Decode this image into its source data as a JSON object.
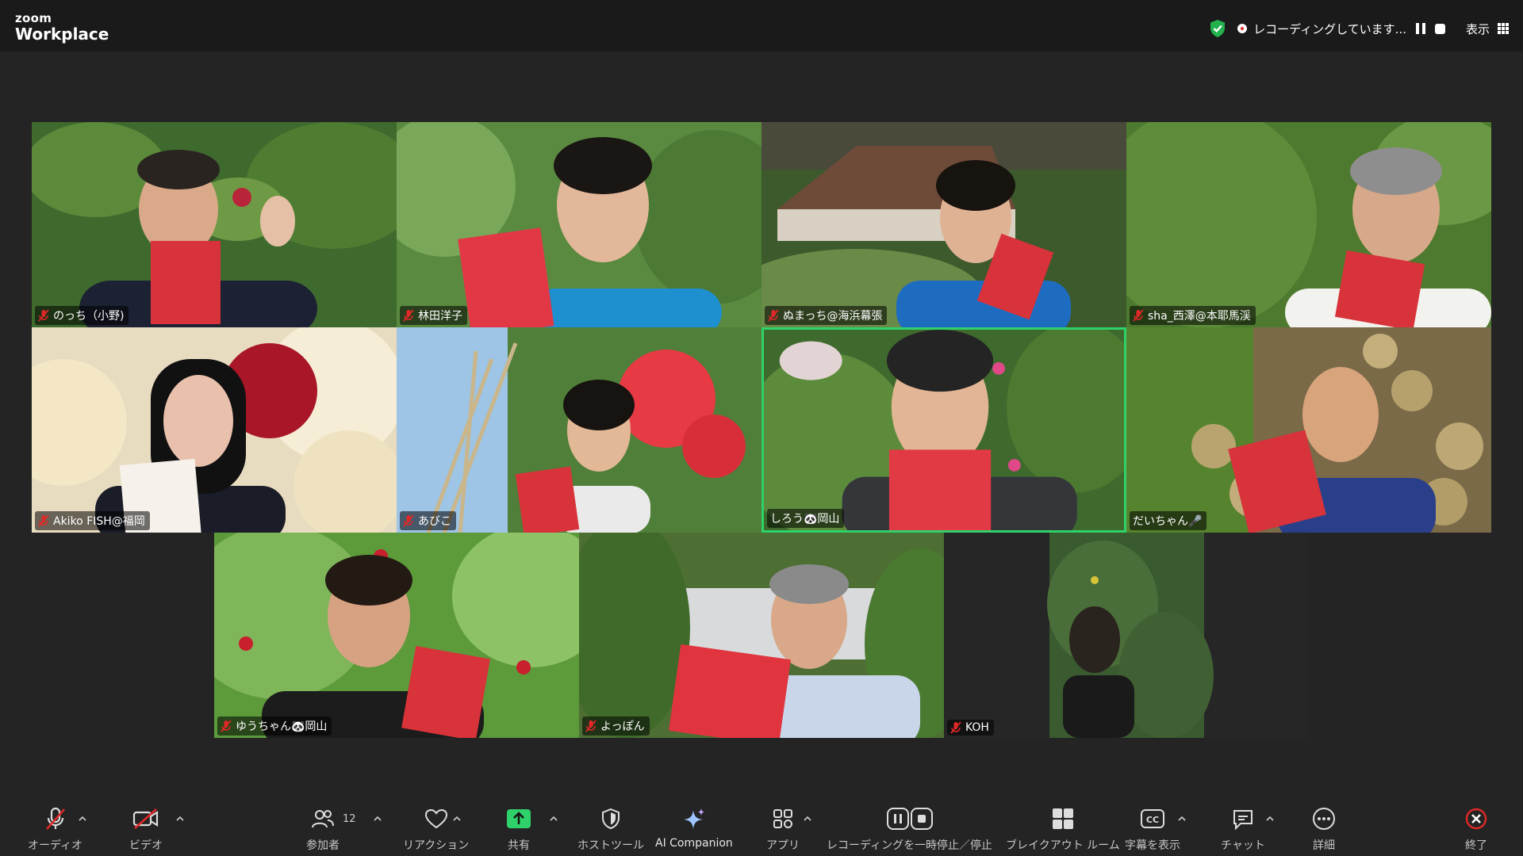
{
  "app": {
    "logo_small": "zoom",
    "logo_big": "Workplace"
  },
  "topbar": {
    "recording_status": "レコーディングしています...",
    "view_label": "表示"
  },
  "participants": [
    {
      "name": "のっち（小野)",
      "muted": true
    },
    {
      "name": "林田洋子",
      "muted": true
    },
    {
      "name": "ぬまっち@海浜幕張",
      "muted": true
    },
    {
      "name": "sha_西澤@本耶馬渓",
      "muted": true
    },
    {
      "name": "Akiko FISH@福岡",
      "muted": true
    },
    {
      "name": "あびこ",
      "muted": true
    },
    {
      "name": "しろう🐼岡山",
      "muted": false,
      "active_speaker": true
    },
    {
      "name": "だいちゃん🎤",
      "muted": false
    },
    {
      "name": "ゆうちゃん🐼岡山",
      "muted": true
    },
    {
      "name": "よっぽん",
      "muted": true
    },
    {
      "name": "KOH",
      "muted": true
    },
    {
      "name": "",
      "muted": false
    }
  ],
  "toolbar": {
    "audio": "オーディオ",
    "video": "ビデオ",
    "participants": "参加者",
    "participants_count": "12",
    "reactions": "リアクション",
    "share": "共有",
    "host_tools": "ホストツール",
    "ai_companion": "AI Companion",
    "apps": "アプリ",
    "recording_control": "レコーディングを一時停止／停止",
    "breakout": "ブレイクアウト ルーム",
    "captions": "字幕を表示",
    "chat": "チャット",
    "more": "詳細",
    "end": "終了"
  },
  "colors": {
    "accent_green": "#2fd16a",
    "end_red": "#e02828",
    "background": "#242424"
  }
}
